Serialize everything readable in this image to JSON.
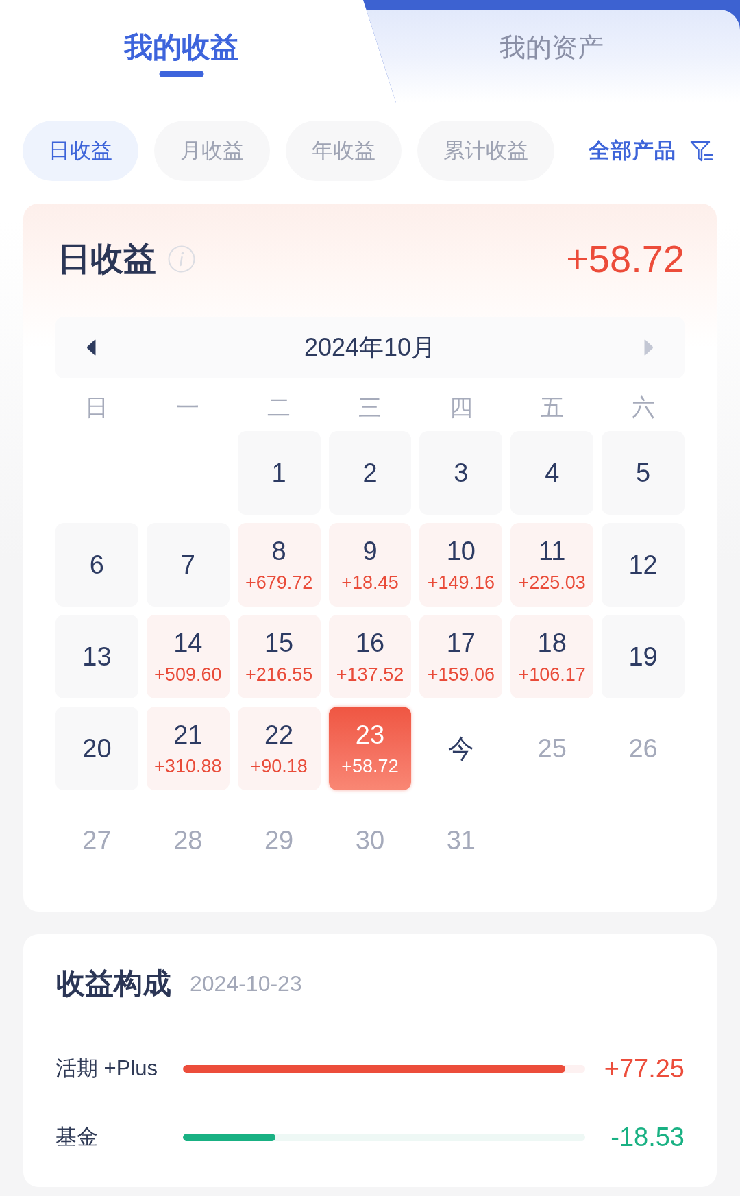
{
  "tabs": [
    {
      "label": "我的收益",
      "selected": true
    },
    {
      "label": "我的资产",
      "selected": false
    }
  ],
  "period_chips": [
    {
      "label": "日收益",
      "selected": true
    },
    {
      "label": "月收益",
      "selected": false
    },
    {
      "label": "年收益",
      "selected": false
    },
    {
      "label": "累计收益",
      "selected": false
    }
  ],
  "product_filter": {
    "label": "全部产品"
  },
  "daily_card": {
    "title": "日收益",
    "amount": "+58.72",
    "calendar": {
      "month": "2024年10月",
      "prev": {
        "disabled": false
      },
      "next": {
        "disabled": true
      },
      "weekdays": [
        "日",
        "一",
        "二",
        "三",
        "四",
        "五",
        "六"
      ],
      "weeks": [
        [
          {
            "day": "1",
            "kind": "plain",
            "selected": false
          },
          {
            "day": "2",
            "kind": "plain",
            "selected": false
          },
          {
            "day": "3",
            "kind": "plain",
            "selected": false
          },
          {
            "day": "4",
            "kind": "plain",
            "selected": false
          },
          {
            "day": "5",
            "kind": "plain",
            "selected": false
          }
        ],
        [
          {
            "day": "6",
            "kind": "plain",
            "selected": false
          },
          {
            "day": "7",
            "kind": "plain",
            "selected": false
          },
          {
            "day": "8",
            "kind": "gain",
            "amount": "+679.72",
            "selected": false
          },
          {
            "day": "9",
            "kind": "gain",
            "amount": "+18.45",
            "selected": false
          },
          {
            "day": "10",
            "kind": "gain",
            "amount": "+149.16",
            "selected": false
          },
          {
            "day": "11",
            "kind": "gain",
            "amount": "+225.03",
            "selected": false
          },
          {
            "day": "12",
            "kind": "plain",
            "selected": false
          }
        ],
        [
          {
            "day": "13",
            "kind": "plain",
            "selected": false
          },
          {
            "day": "14",
            "kind": "gain",
            "amount": "+509.60",
            "selected": false
          },
          {
            "day": "15",
            "kind": "gain",
            "amount": "+216.55",
            "selected": false
          },
          {
            "day": "16",
            "kind": "gain",
            "amount": "+137.52",
            "selected": false
          },
          {
            "day": "17",
            "kind": "gain",
            "amount": "+159.06",
            "selected": false
          },
          {
            "day": "18",
            "kind": "gain",
            "amount": "+106.17",
            "selected": false
          },
          {
            "day": "19",
            "kind": "plain",
            "selected": false
          }
        ],
        [
          {
            "day": "20",
            "kind": "plain",
            "selected": false
          },
          {
            "day": "21",
            "kind": "gain",
            "amount": "+310.88",
            "selected": false
          },
          {
            "day": "22",
            "kind": "gain",
            "amount": "+90.18",
            "selected": false
          },
          {
            "day": "23",
            "kind": "gain",
            "amount": "+58.72",
            "selected": true
          },
          {
            "day": "今",
            "kind": "today",
            "selected": false
          },
          {
            "day": "25",
            "kind": "future",
            "selected": false
          },
          {
            "day": "26",
            "kind": "future",
            "selected": false
          }
        ],
        [
          {
            "day": "27",
            "kind": "future",
            "selected": false
          },
          {
            "day": "28",
            "kind": "future",
            "selected": false
          },
          {
            "day": "29",
            "kind": "future",
            "selected": false
          },
          {
            "day": "30",
            "kind": "future",
            "selected": false
          },
          {
            "day": "31",
            "kind": "future",
            "selected": false
          }
        ]
      ]
    }
  },
  "breakdown": {
    "title": "收益构成",
    "date": "2024-10-23",
    "items": [
      {
        "name": "活期 +Plus",
        "kind": "gain",
        "level": 0.95,
        "amount": "+77.25"
      },
      {
        "name": "基金",
        "kind": "loss",
        "level": 0.23,
        "amount": "-18.53"
      }
    ]
  }
}
